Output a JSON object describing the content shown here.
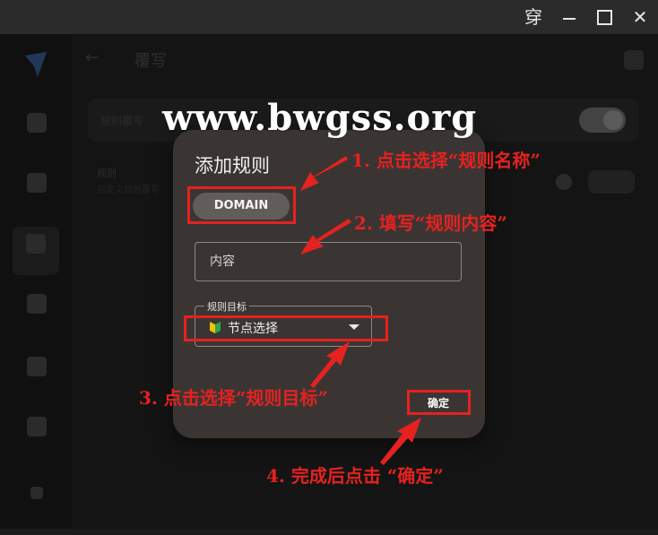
{
  "window": {
    "pin_glyph": "穿",
    "close_glyph": "✕"
  },
  "header": {
    "back_glyph": "←",
    "title": "覆写"
  },
  "background": {
    "row_label": "规则覆写",
    "item_title": "规则",
    "item_subtitle": "自定义规则覆写"
  },
  "watermark": "www.bwgss.org",
  "dialog": {
    "title": "添加规则",
    "rule_type": "DOMAIN",
    "content_placeholder": "内容",
    "target_label": "规则目标",
    "target_value": "节点选择",
    "confirm": "确定"
  },
  "annotations": {
    "step1": "1. 点击选择“规则名称”",
    "step2": "2. 填写“规则内容”",
    "step3": "3. 点击选择“规则目标”",
    "step4": "4. 完成后点击 “确定”"
  },
  "colors": {
    "annotation_red": "#e52220",
    "dialog_bg": "#3a3533",
    "chip_bg": "#625c5a"
  }
}
